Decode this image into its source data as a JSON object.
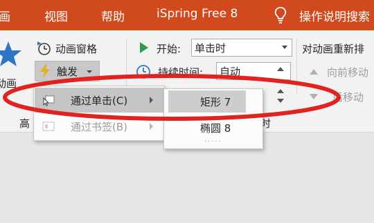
{
  "menubar": {
    "tabs": [
      {
        "id": "animations",
        "label": "画"
      },
      {
        "id": "view",
        "label": "视图"
      },
      {
        "id": "help",
        "label": "帮助"
      },
      {
        "id": "ispring",
        "label": "iSpring Free 8"
      },
      {
        "id": "tell_me",
        "label": "操作说明搜索"
      }
    ]
  },
  "ribbon": {
    "add_animation_label": "动画",
    "animation_pane_label": "动画窗格",
    "trigger_label": "触发",
    "group_advanced_label": "高",
    "group_timing_label": "时",
    "start_label": "开始:",
    "start_value": "单击时",
    "duration_label": "持续时间:",
    "duration_value": "自动",
    "reorder_header": "对动画重新排",
    "move_earlier_label": "向前移动",
    "move_later_label": "后移动"
  },
  "trigger_menu": {
    "items": [
      {
        "label": "通过单击(C)",
        "enabled": true,
        "highlighted": true
      },
      {
        "label": "通过书签(B)",
        "enabled": false,
        "highlighted": false
      }
    ]
  },
  "click_submenu": {
    "options": [
      {
        "label": "矩形 7",
        "highlighted": true
      },
      {
        "label": "椭圆 8",
        "highlighted": false
      }
    ],
    "more_indicator": "....."
  },
  "colors": {
    "menubar_bg": "#d04a1e",
    "ribbon_bg": "#f2f2f2",
    "annotation_ellipse": "#e2221e",
    "star_icon": "#2e75c7"
  }
}
